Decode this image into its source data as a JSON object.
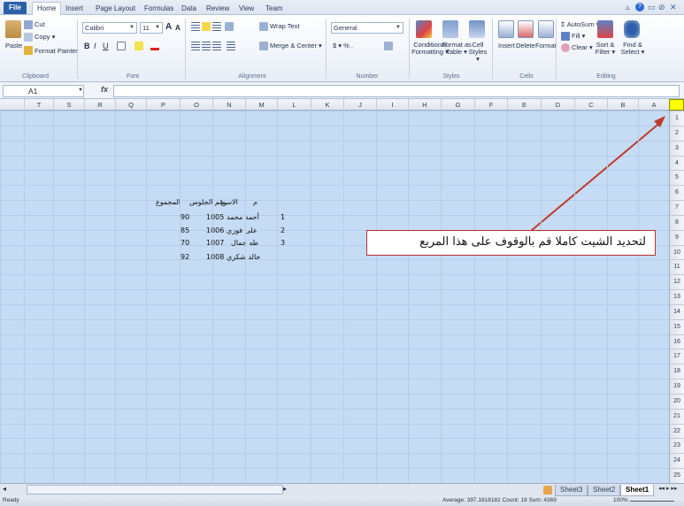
{
  "ribbon_tabs": [
    "File",
    "Home",
    "Insert",
    "Page Layout",
    "Formulas",
    "Data",
    "Review",
    "View",
    "Team"
  ],
  "active_tab": "Home",
  "window_controls": [
    "▵",
    "?",
    "▭",
    "⊘",
    "✕"
  ],
  "clipboard": {
    "cut": "Cut",
    "copy": "Copy ▾",
    "paste": "Paste",
    "format_painter": "Format Painter",
    "label": "Clipboard"
  },
  "font": {
    "name": "Calibri",
    "size": "11",
    "grow": "A",
    "shrink": "A",
    "bold": "B",
    "italic": "I",
    "underline": "U",
    "label": "Font"
  },
  "alignment": {
    "wrap_text": "Wrap Text",
    "merge_center": "Merge & Center ▾",
    "label": "Alignment"
  },
  "number": {
    "format": "General",
    "currency": "$ ▾ %  ,",
    "label": "Number"
  },
  "styles": {
    "conditional": "Conditional Formatting ▾",
    "format_table": "Format as Table ▾",
    "cell_styles": "Cell Styles ▾",
    "label": "Styles"
  },
  "cells": {
    "insert": "Insert",
    "delete": "Delete",
    "format": "Format",
    "label": "Cells"
  },
  "editing": {
    "autosum": "Σ AutoSum ▾",
    "fill": "Fill ▾",
    "clear": "Clear ▾",
    "sort_filter": "Sort & Filter ▾",
    "find_select": "Find & Select ▾",
    "label": "Editing"
  },
  "formula_bar": {
    "name_box": "A1",
    "fx": "fx",
    "value": ""
  },
  "columns": [
    "T",
    "S",
    "R",
    "Q",
    "P",
    "O",
    "N",
    "M",
    "L",
    "K",
    "J",
    "I",
    "H",
    "G",
    "F",
    "E",
    "D",
    "C",
    "B",
    "A"
  ],
  "rows": [
    "1",
    "2",
    "3",
    "4",
    "5",
    "6",
    "7",
    "8",
    "9",
    "10",
    "11",
    "12",
    "13",
    "14",
    "15",
    "16",
    "17",
    "18",
    "19",
    "20",
    "21",
    "22",
    "23",
    "24",
    "25"
  ],
  "table": {
    "headers": {
      "seq": "م",
      "name": "الاسم",
      "seat": "رقم الجلوس",
      "total": "المجموع"
    },
    "rows": [
      {
        "seq": "1",
        "name": "أحمد محمد",
        "seat": "1005",
        "total": "90"
      },
      {
        "seq": "2",
        "name": "على فوزي",
        "seat": "1006",
        "total": "85"
      },
      {
        "seq": "3",
        "name": "طه جمال",
        "seat": "1007",
        "total": "70"
      },
      {
        "seq": "",
        "name": "خالد شكري",
        "seat": "1008",
        "total": "92"
      }
    ]
  },
  "annotation": {
    "text": "لتحديد الشيت كاملا قم بالوقوف على هذا المربع",
    "border_color": "#b73030",
    "arrow_color": "#c0392b"
  },
  "select_all_color": "#ffff00",
  "sheets": [
    "Sheet3",
    "Sheet2",
    "Sheet1"
  ],
  "active_sheet": "Sheet1",
  "status": {
    "ready": "Ready",
    "summary": "Average: 397.1818182    Count: 19    Sum: 4369",
    "zoom": "100%"
  }
}
